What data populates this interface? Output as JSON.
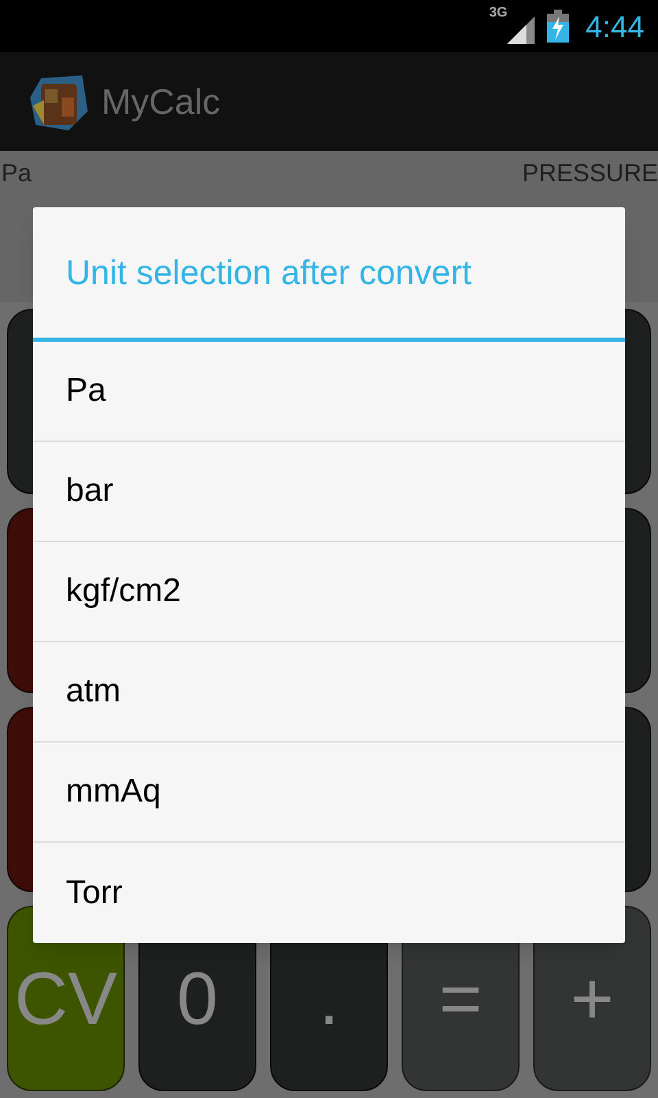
{
  "status_bar": {
    "network": "3G",
    "time": "4:44"
  },
  "action_bar": {
    "title": "MyCalc"
  },
  "display": {
    "unit": "Pa",
    "category": "PRESSURE"
  },
  "keypad": {
    "rows": [
      {
        "keys": [
          {
            "kind": "dark"
          },
          {
            "kind": "dark"
          }
        ]
      },
      {
        "keys": [
          {
            "kind": "red"
          },
          {
            "kind": "dark"
          }
        ]
      },
      {
        "keys": [
          {
            "kind": "red"
          },
          {
            "kind": "dark"
          }
        ]
      },
      {
        "keys": [
          {
            "label": "CV",
            "kind": "green"
          },
          {
            "label": "0",
            "kind": "dark"
          },
          {
            "label": ".",
            "kind": "dark"
          },
          {
            "label": "=",
            "kind": "gray"
          },
          {
            "label": "+",
            "kind": "gray"
          }
        ]
      }
    ]
  },
  "dialog": {
    "title": "Unit selection after convert",
    "items": [
      "Pa",
      "bar",
      "kgf/cm2",
      "atm",
      "mmAq",
      "Torr"
    ]
  }
}
